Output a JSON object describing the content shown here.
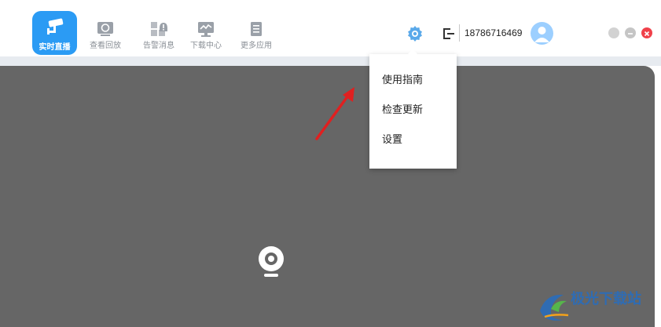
{
  "nav": {
    "items": [
      {
        "label": "实时直播",
        "icon": "cctv-camera-icon",
        "active": true
      },
      {
        "label": "查看回放",
        "icon": "playback-icon"
      },
      {
        "label": "告警消息",
        "icon": "alarm-message-icon"
      },
      {
        "label": "下载中心",
        "icon": "download-center-icon"
      },
      {
        "label": "更多应用",
        "icon": "more-apps-icon"
      }
    ]
  },
  "header": {
    "phone": "18786716469"
  },
  "settings_menu": {
    "items": [
      "使用指南",
      "检查更新",
      "设置"
    ]
  },
  "watermark": {
    "text": "极光下载站"
  },
  "colors": {
    "accent": "#2b9bf4",
    "video_bg": "#666666",
    "close": "#f0414a",
    "arrow": "#e02020"
  }
}
